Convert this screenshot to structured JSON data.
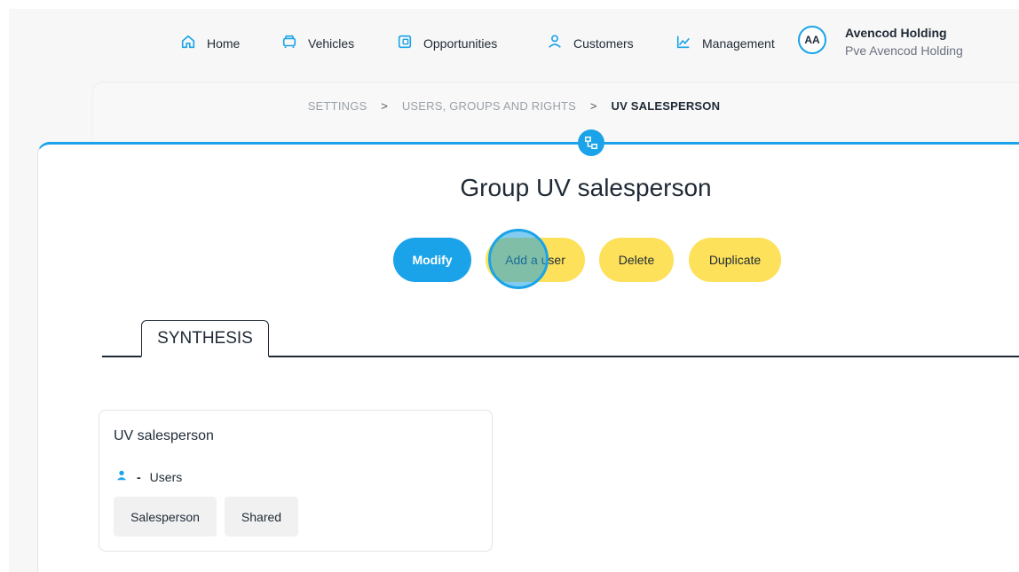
{
  "nav": {
    "items": [
      {
        "label": "Home",
        "icon": "home-icon"
      },
      {
        "label": "Vehicles",
        "icon": "vehicle-icon"
      },
      {
        "label": "Opportunities",
        "icon": "wallet-icon"
      },
      {
        "label": "Customers",
        "icon": "user-icon"
      },
      {
        "label": "Management",
        "icon": "chart-icon"
      }
    ],
    "avatar_initials": "AA",
    "account_name": "Avencod Holding",
    "account_sub": "Pve Avencod Holding"
  },
  "breadcrumb": {
    "items": [
      "SETTINGS",
      "USERS, GROUPS AND RIGHTS",
      "UV SALESPERSON"
    ],
    "separator": ">"
  },
  "page": {
    "title": "Group UV salesperson"
  },
  "actions": {
    "modify": "Modify",
    "add_user": "Add a user",
    "delete": "Delete",
    "duplicate": "Duplicate"
  },
  "tabs": [
    {
      "label": "SYNTHESIS",
      "active": true
    }
  ],
  "group_card": {
    "title": "UV salesperson",
    "users_count": "-",
    "users_label": "Users",
    "tags": [
      "Salesperson",
      "Shared"
    ]
  },
  "colors": {
    "accent": "#1aa3e8",
    "secondary_button": "#fde15a",
    "text": "#1f2a36"
  }
}
